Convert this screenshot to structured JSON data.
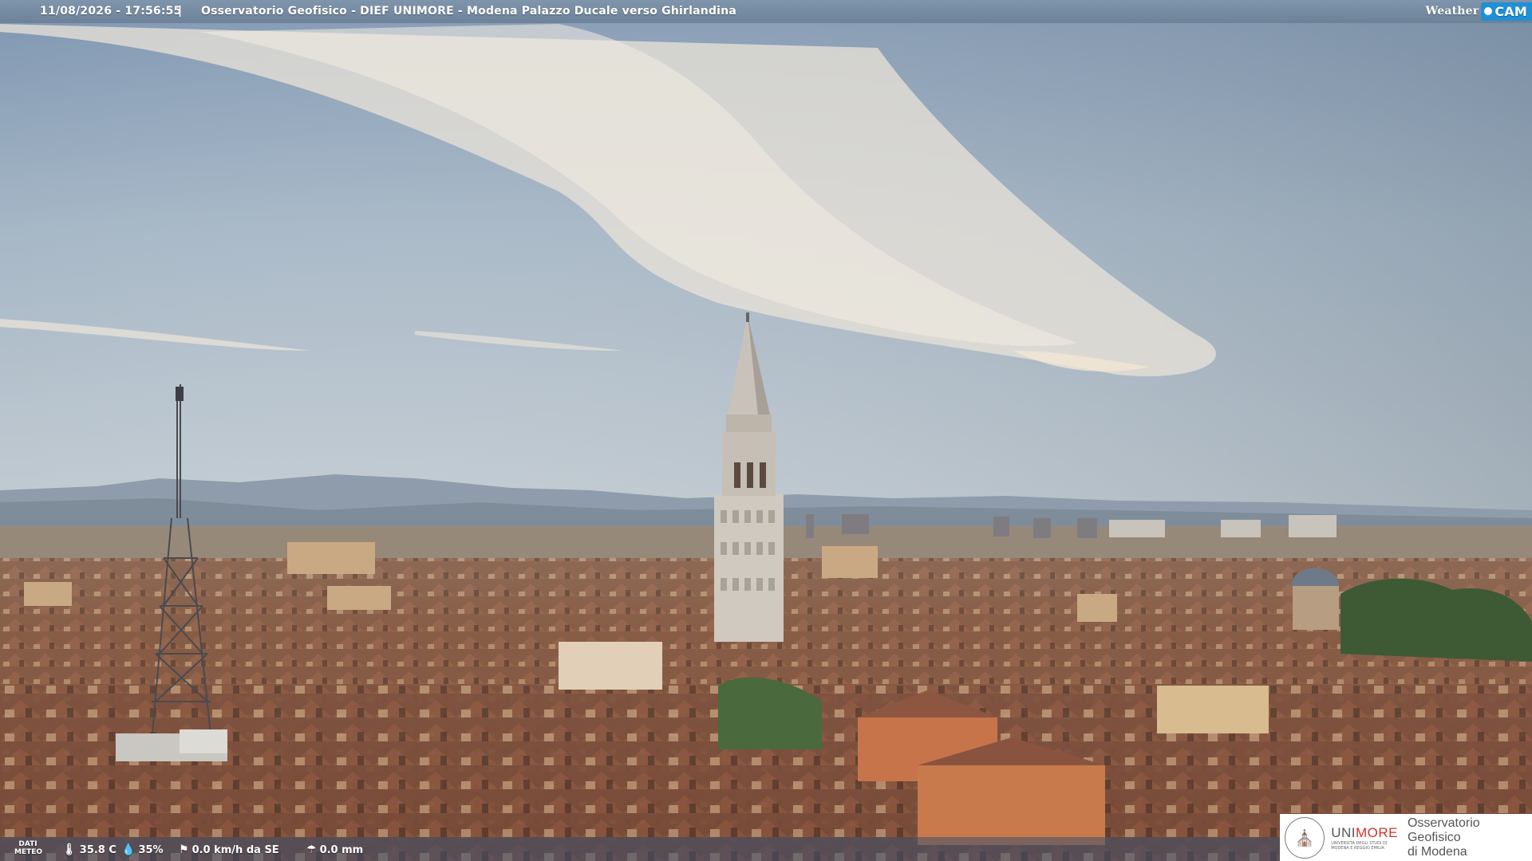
{
  "header": {
    "timestamp": "11/08/2026 - 17:56:55",
    "separator": "|",
    "title": "Osservatorio Geofisico - DIEF UNIMORE - Modena Palazzo Ducale verso Ghirlandina",
    "brand_weather": "Weather",
    "brand_cam": "CAM"
  },
  "weather": {
    "label_line1": "DATI",
    "label_line2": "METEO",
    "temperature": "35.8 C",
    "humidity": "35%",
    "wind": "0.0 km/h da SE",
    "rain": "0.0 mm",
    "icons": [
      "thermometer-icon",
      "humidity-drop-icon",
      "wind-vane-icon",
      "rain-gauge-icon"
    ]
  },
  "logo": {
    "uni_prefix": "UNI",
    "uni_suffix": "MORE",
    "uni_sub_1": "UNIVERSITÀ DEGLI STUDI DI",
    "uni_sub_2": "MODENA E REGGIO EMILIA",
    "obs_line1": "Osservatorio Geofisico",
    "obs_line2": "di Modena"
  },
  "colors": {
    "sky_top": "#7f97b3",
    "sky_mid": "#b9c6cf",
    "cloud": "#e8e1d6",
    "roof": "#8a5a44",
    "brand_blue": "#1f8fd6",
    "brand_red": "#d2332a"
  }
}
